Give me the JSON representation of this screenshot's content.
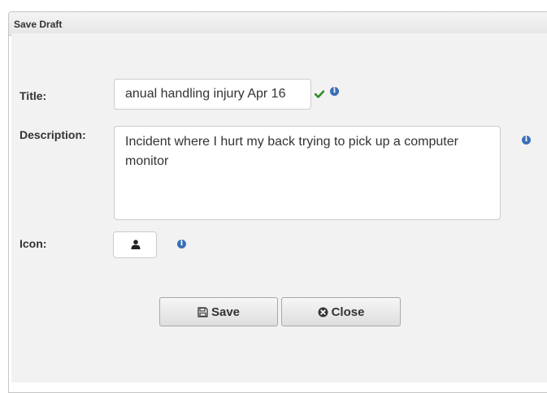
{
  "dialog": {
    "title": "Save Draft"
  },
  "form": {
    "title_label": "Title:",
    "title_value": "anual handling injury Apr 16",
    "description_label": "Description:",
    "description_value": "Incident where I hurt my back trying to pick up a computer monitor",
    "icon_label": "Icon:",
    "icon_name": "user-icon",
    "valid_color": "#2e8b2e",
    "info_color": "#3a6fb7"
  },
  "buttons": {
    "save_label": "Save",
    "save_icon": "floppy-disk-icon",
    "close_label": "Close",
    "close_icon": "close-circle-icon"
  }
}
